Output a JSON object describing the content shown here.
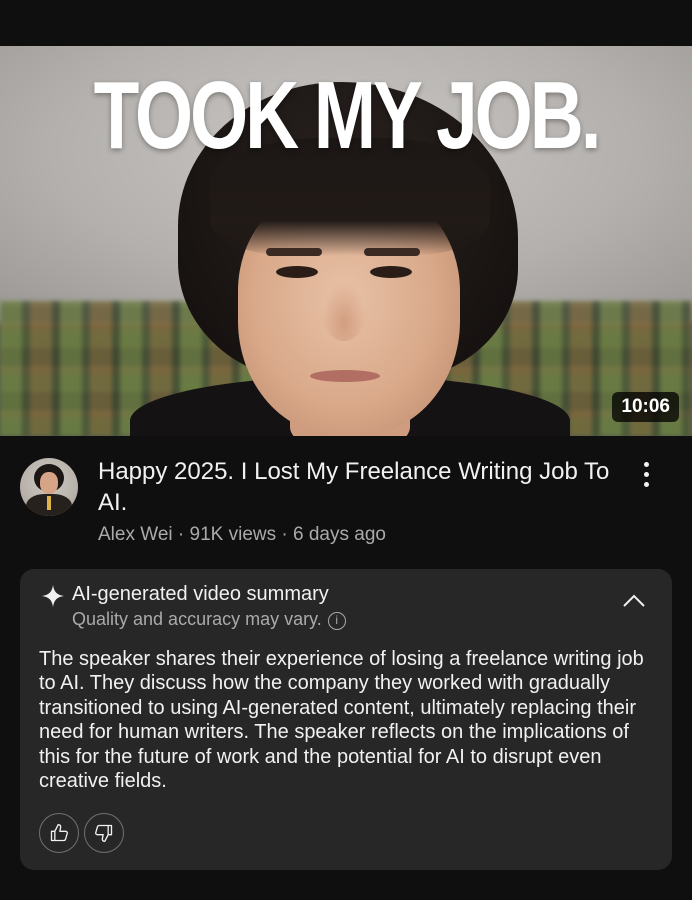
{
  "thumbnail": {
    "headline": "TOOK MY JOB.",
    "duration": "10:06"
  },
  "video": {
    "title": "Happy 2025. I Lost My Freelance Writing Job To AI.",
    "channel": "Alex Wei",
    "separator": " · ",
    "views": "91K views",
    "age": "6 days ago"
  },
  "summary": {
    "icon": "sparkle-icon",
    "title": "AI-generated video summary",
    "subtitle": "Quality and accuracy may vary.",
    "body": "The speaker shares their experience of losing a freelance writing job to AI. They discuss how the company they worked with gradually transitioned to using AI-generated content, ultimately replacing their need for human writers. The speaker reflects on the implications of this for the future of work and the potential for AI to disrupt even creative fields."
  },
  "colors": {
    "background": "#0f0f0f",
    "card": "#272727",
    "text": "#f1f1f1",
    "secondary_text": "#aaaaaa"
  }
}
